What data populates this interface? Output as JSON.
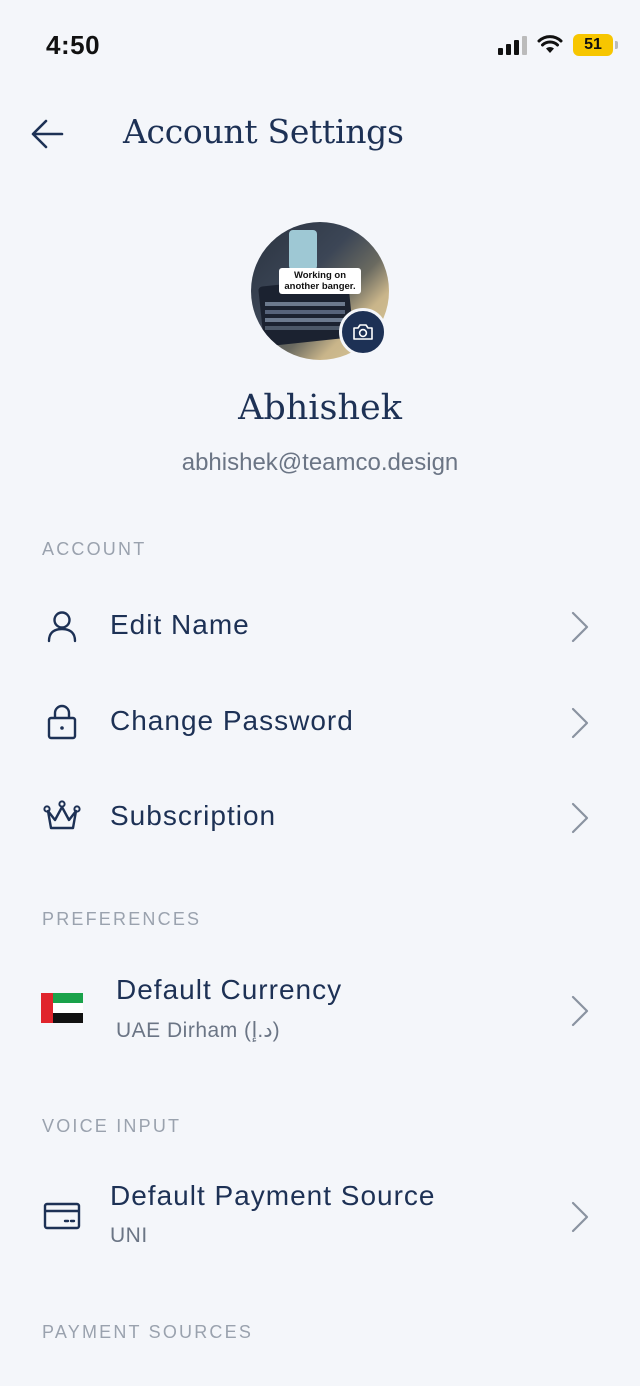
{
  "status_bar": {
    "time": "4:50",
    "battery": "51"
  },
  "header": {
    "title": "Account Settings"
  },
  "profile": {
    "avatar_caption": "Working on another banger.",
    "name": "Abhishek",
    "email": "abhishek@teamco.design"
  },
  "sections": {
    "account": "ACCOUNT",
    "preferences": "PREFERENCES",
    "voice_input": "VOICE INPUT",
    "payment_sources": "PAYMENT SOURCES"
  },
  "account_items": [
    {
      "label": "Edit Name",
      "icon": "user-icon"
    },
    {
      "label": "Change Password",
      "icon": "lock-icon"
    },
    {
      "label": "Subscription",
      "icon": "crown-icon"
    }
  ],
  "preferences": {
    "currency_label": "Default Currency",
    "currency_value": "UAE Dirham (د.إ)",
    "flag_icon": "uae-flag-icon"
  },
  "voice_input": {
    "payment_label": "Default Payment Source",
    "payment_value": "UNI",
    "icon": "card-icon"
  },
  "colors": {
    "primary": "#1d3155",
    "background": "#f4f6fa",
    "muted": "#6b7585",
    "battery": "#f7c600"
  }
}
